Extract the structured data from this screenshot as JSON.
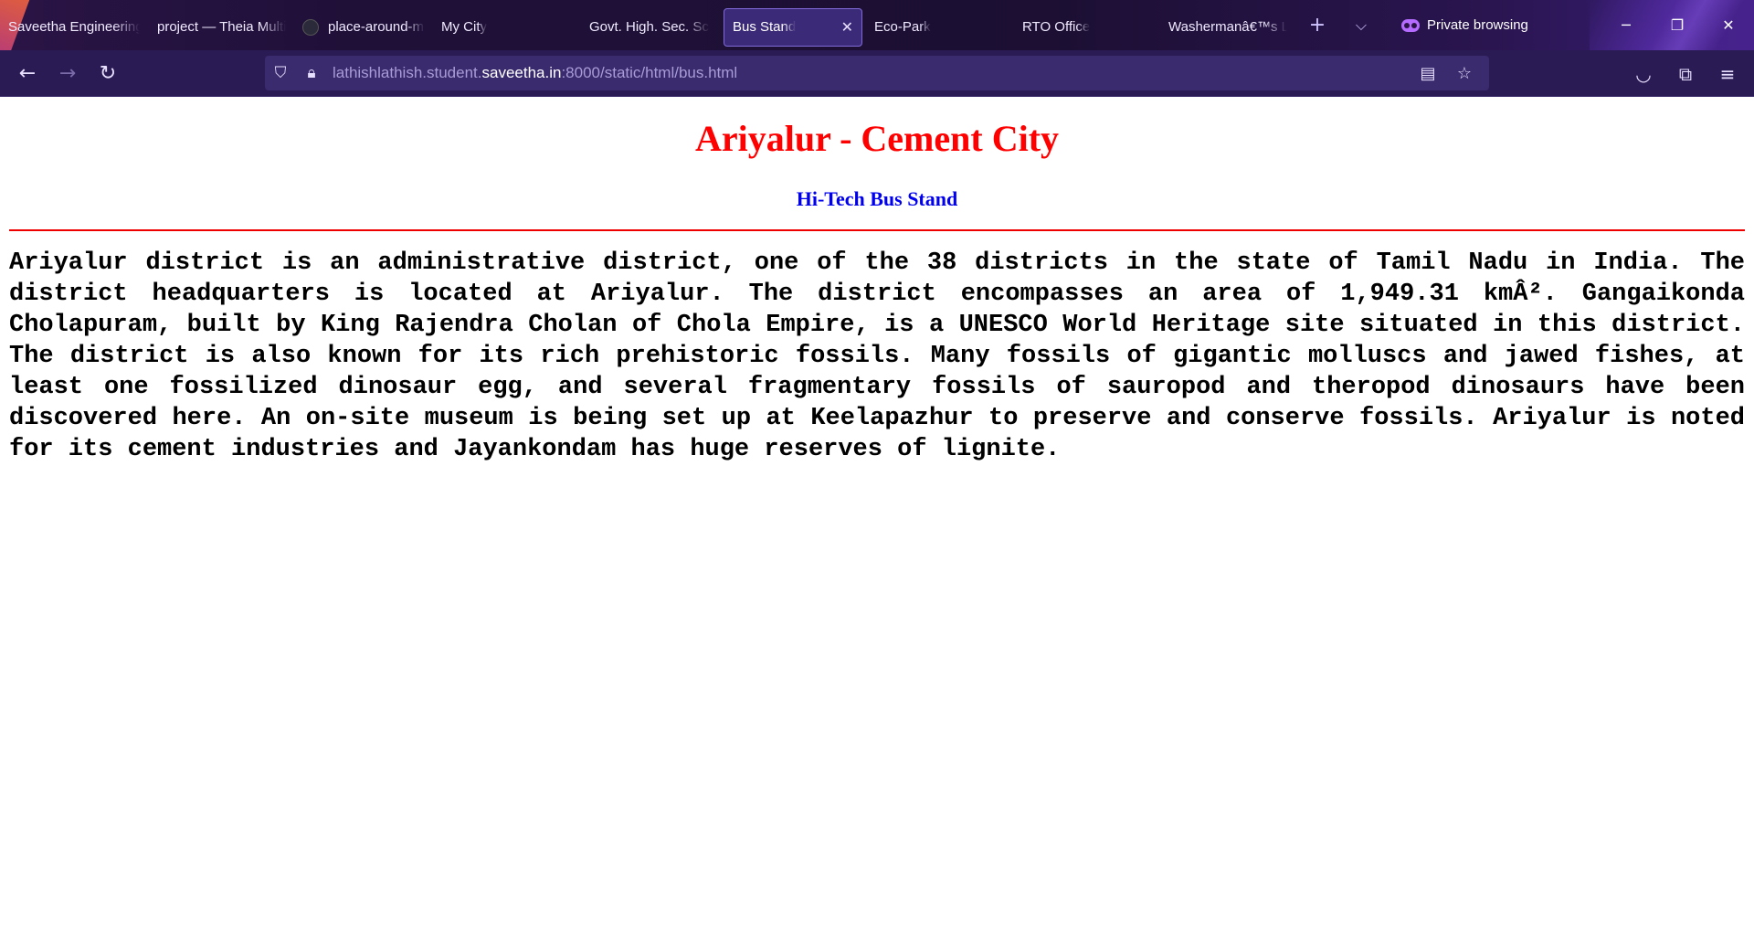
{
  "browser": {
    "tabs": [
      {
        "label": "Saveetha Engineering College"
      },
      {
        "label": "project — Theia Multi-Language Example"
      },
      {
        "label": "place-around-me"
      },
      {
        "label": "My City"
      },
      {
        "label": "Govt. High. Sec. School"
      },
      {
        "label": "Bus Stand",
        "active": true
      },
      {
        "label": "Eco-Park"
      },
      {
        "label": "RTO Office"
      },
      {
        "label": "Washermanâ€™s Lake"
      }
    ],
    "private_label": "Private browsing",
    "url_prefix": "lathishlathish.student.",
    "url_host": "saveetha.in",
    "url_suffix": ":8000/static/html/bus.html",
    "icons": {
      "back": "back-arrow-icon",
      "forward": "forward-arrow-icon",
      "reload": "reload-icon",
      "shield": "shield-icon",
      "lock": "lock-icon",
      "reader": "reader-view-icon",
      "bookmark": "star-icon",
      "pocket": "pocket-icon",
      "extensions": "extensions-icon",
      "menu": "hamburger-menu-icon"
    }
  },
  "page": {
    "title": "Ariyalur - Cement City",
    "subtitle": "Hi-Tech Bus Stand",
    "paragraph": "Ariyalur district is an administrative district, one of the 38 districts in the state of Tamil Nadu in India. The district headquarters is located at Ariyalur. The district encompasses an area of 1,949.31 kmÂ². Gangaikonda Cholapuram, built by King Rajendra Cholan of Chola Empire, is a UNESCO World Heritage site situated in this district. The district is also known for its rich prehistoric fossils. Many fossils of gigantic molluscs and jawed fishes, at least one fossilized dinosaur egg, and several fragmentary fossils of sauropod and theropod dinosaurs have been discovered here. An on-site museum is being set up at Keelapazhur to preserve and conserve fossils. Ariyalur is noted for its cement industries and Jayankondam has huge reserves of lignite."
  },
  "colors": {
    "title": "#ff0000",
    "subtitle": "#0000ee",
    "rule": "#ee0000"
  }
}
